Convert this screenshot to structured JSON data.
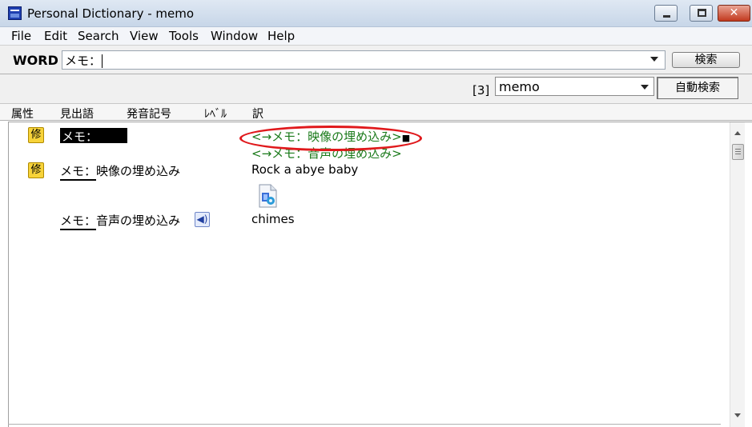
{
  "window": {
    "title": "Personal Dictionary - memo",
    "minimize_glyph": "",
    "close_glyph": "✕"
  },
  "menu": [
    "File",
    "Edit",
    "Search",
    "View",
    "Tools",
    "Window",
    "Help"
  ],
  "search": {
    "label": "WORD",
    "value": "メモ：",
    "button": "検索"
  },
  "dictionary": {
    "count": "[3]",
    "selected": "memo",
    "auto_search_button": "自動検索"
  },
  "columns": [
    "属性",
    "見出語",
    "発音記号",
    "ﾚﾍﾞﾙ",
    "訳"
  ],
  "entries": [
    {
      "badge": "修",
      "headword": "メモ：",
      "translation_lines": [
        "<→メモ：映像の埋め込み>",
        "<→メモ：音声の埋め込み>"
      ],
      "bullet": "■"
    },
    {
      "badge": "修",
      "headword_underlined": "メモ：",
      "headword_rest": "映像の埋め込み",
      "translation": "Rock a abye baby"
    },
    {
      "headword_underlined": "メモ：",
      "headword_rest": "音声の埋め込み",
      "translation": "chimes"
    }
  ],
  "icons": {
    "app": "dictionary-app-icon",
    "sound": "speaker-icon",
    "media": "audio-file-icon"
  },
  "colors": {
    "link": "#1a7a1a",
    "highlight": "#e0191c",
    "badge": "#f7d33a",
    "selection": "#000000"
  }
}
